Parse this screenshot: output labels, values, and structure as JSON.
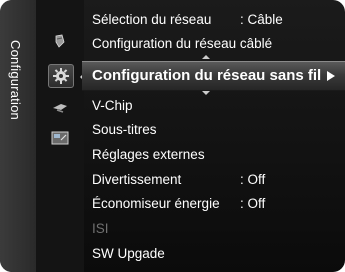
{
  "sidebar": {
    "label": "Configuration"
  },
  "icons": [
    {
      "name": "picture-icon"
    },
    {
      "name": "setup-gear-icon"
    },
    {
      "name": "input-icon"
    },
    {
      "name": "application-icon"
    }
  ],
  "menu": {
    "items": [
      {
        "label": "Sélection du réseau",
        "value": ": Câble"
      },
      {
        "label": "Configuration du réseau câblé",
        "value": ""
      },
      {
        "label": "Configuration du réseau sans fil",
        "value": ""
      },
      {
        "label": "V-Chip",
        "value": ""
      },
      {
        "label": "Sous-titres",
        "value": ""
      },
      {
        "label": "Réglages externes",
        "value": ""
      },
      {
        "label": "Divertissement",
        "value": ": Off"
      },
      {
        "label": "Économiseur énergie",
        "value": ": Off"
      },
      {
        "label": "ISI",
        "value": ""
      },
      {
        "label": "SW Upgade",
        "value": ""
      }
    ],
    "selected_index": 2
  },
  "colors": {
    "text": "#ffffff",
    "disabled_text": "#707070",
    "background": "#111111",
    "highlight": "#4a4a4a"
  }
}
